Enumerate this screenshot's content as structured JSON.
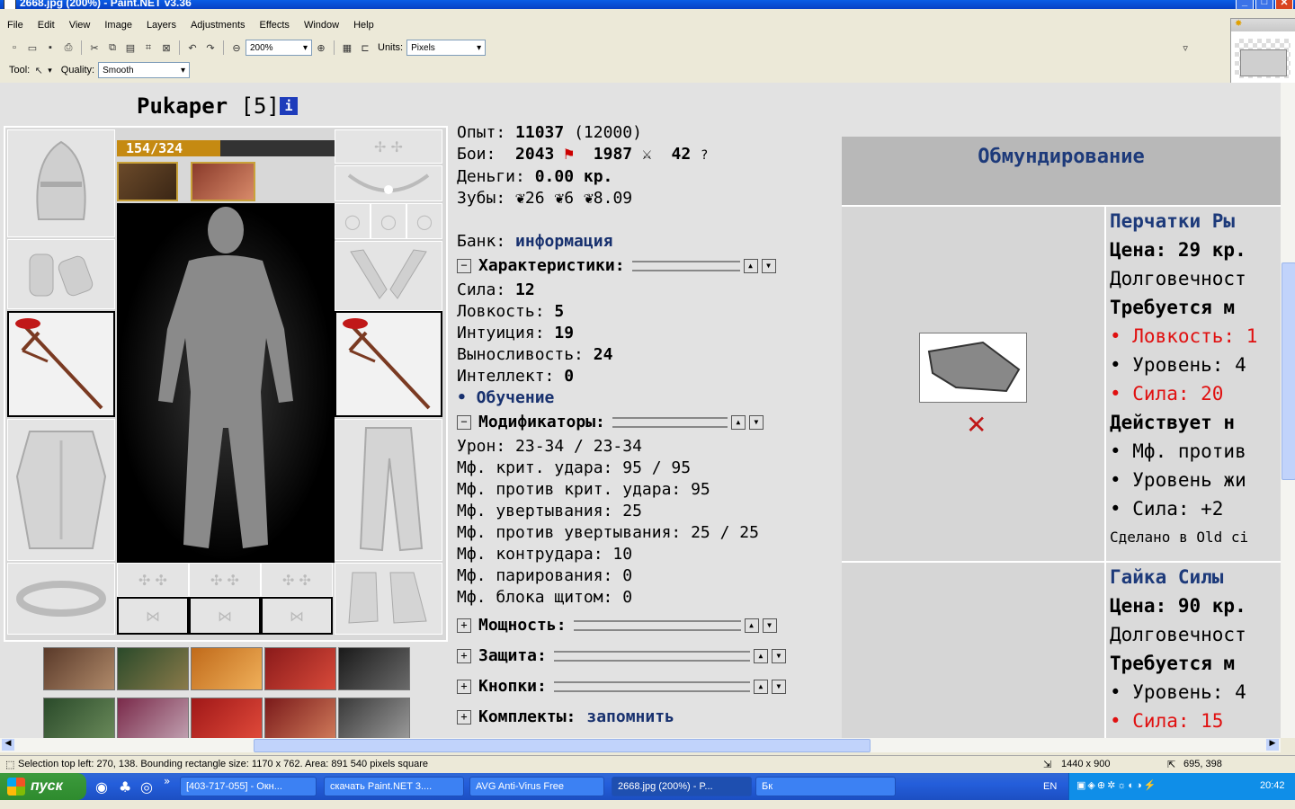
{
  "window": {
    "title": "2668.jpg (200%) - Paint.NET v3.36"
  },
  "menu": [
    "File",
    "Edit",
    "View",
    "Image",
    "Layers",
    "Adjustments",
    "Effects",
    "Window",
    "Help"
  ],
  "toolbar": {
    "zoom": "200%",
    "units_label": "Units:",
    "units_value": "Pixels"
  },
  "toolbar2": {
    "tool_label": "Tool:",
    "quality_label": "Quality:",
    "quality_value": "Smooth"
  },
  "page": {
    "nick": "Pukaper",
    "level": "[5]",
    "info_icon": "i",
    "hp": "154/324",
    "hp_fraction": 0.475,
    "stats": {
      "exp_label": "Опыт:",
      "exp_value": "11037",
      "exp_next": "(12000)",
      "battles_label": "Бои:",
      "wins": "2043",
      "losses": "1987",
      "draws": "42",
      "money_label": "Деньги:",
      "money_value": "0.00 кр.",
      "teeth_label": "Зубы:",
      "teeth1": "26",
      "teeth2": "6",
      "teeth3": "8.09",
      "bank_label": "Банк:",
      "bank_link": "информация"
    },
    "sections": {
      "characteristics": "Характеристики:",
      "modifiers": "Модификаторы:",
      "power": "Мощность:",
      "defense": "Защита:",
      "buttons": "Кнопки:",
      "sets": "Комплекты:",
      "remember": "запомнить"
    },
    "chars": [
      {
        "label": "Сила:",
        "value": "12"
      },
      {
        "label": "Ловкость:",
        "value": "5"
      },
      {
        "label": "Интуиция:",
        "value": "19"
      },
      {
        "label": "Выносливость:",
        "value": "24"
      },
      {
        "label": "Интеллект:",
        "value": "0"
      }
    ],
    "training_link": "• Обучение",
    "mods": [
      {
        "label": "Урон:",
        "value": "23-34 / 23-34"
      },
      {
        "label": "Мф. крит. удара:",
        "value": "95 / 95"
      },
      {
        "label": "Мф. против крит. удара:",
        "value": "95"
      },
      {
        "label": "Мф. увертывания:",
        "value": "25"
      },
      {
        "label": "Мф. против увертывания:",
        "value": "25 / 25"
      },
      {
        "label": "Мф. контрудара:",
        "value": "10"
      },
      {
        "label": "Мф. парирования:",
        "value": "0"
      },
      {
        "label": "Мф. блока щитом:",
        "value": "0"
      }
    ],
    "shop": {
      "header": "Обмундирование",
      "item1": {
        "title": "Перчатки Ры",
        "price": "Цена: 29 кр.",
        "durability": "Долговечност",
        "req": "Требуется м",
        "req_items": [
          {
            "text": "• Ловкость: 1",
            "red": true
          },
          {
            "text": "• Уровень: 4",
            "red": false
          },
          {
            "text": "• Сила: 20",
            "red": true
          }
        ],
        "acts": "Действует н",
        "act_items": [
          "• Мф. против",
          "• Уровень жи",
          "• Сила: +2"
        ],
        "made": "Сделано в Old ci"
      },
      "item2": {
        "title": "Гайка Силы",
        "price": "Цена: 90 кр.",
        "durability": "Долговечност",
        "req": "Требуется м",
        "req_items": [
          {
            "text": "• Уровень: 4",
            "red": false
          },
          {
            "text": "• Сила: 15",
            "red": true
          }
        ]
      }
    }
  },
  "statusbar": {
    "selection": "Selection top left: 270, 138. Bounding rectangle size: 1170 x 762. Area: 891 540 pixels square",
    "image_size": "1440 x 900",
    "cursor": "695, 398"
  },
  "taskbar": {
    "start": "пуск",
    "tasks": [
      "[403-717-055] - Окн...",
      "скачать Paint.NET 3....",
      "AVG Anti-Virus Free",
      "2668.jpg (200%) - P...",
      "Бк"
    ],
    "lang": "EN",
    "clock": "20:42"
  }
}
